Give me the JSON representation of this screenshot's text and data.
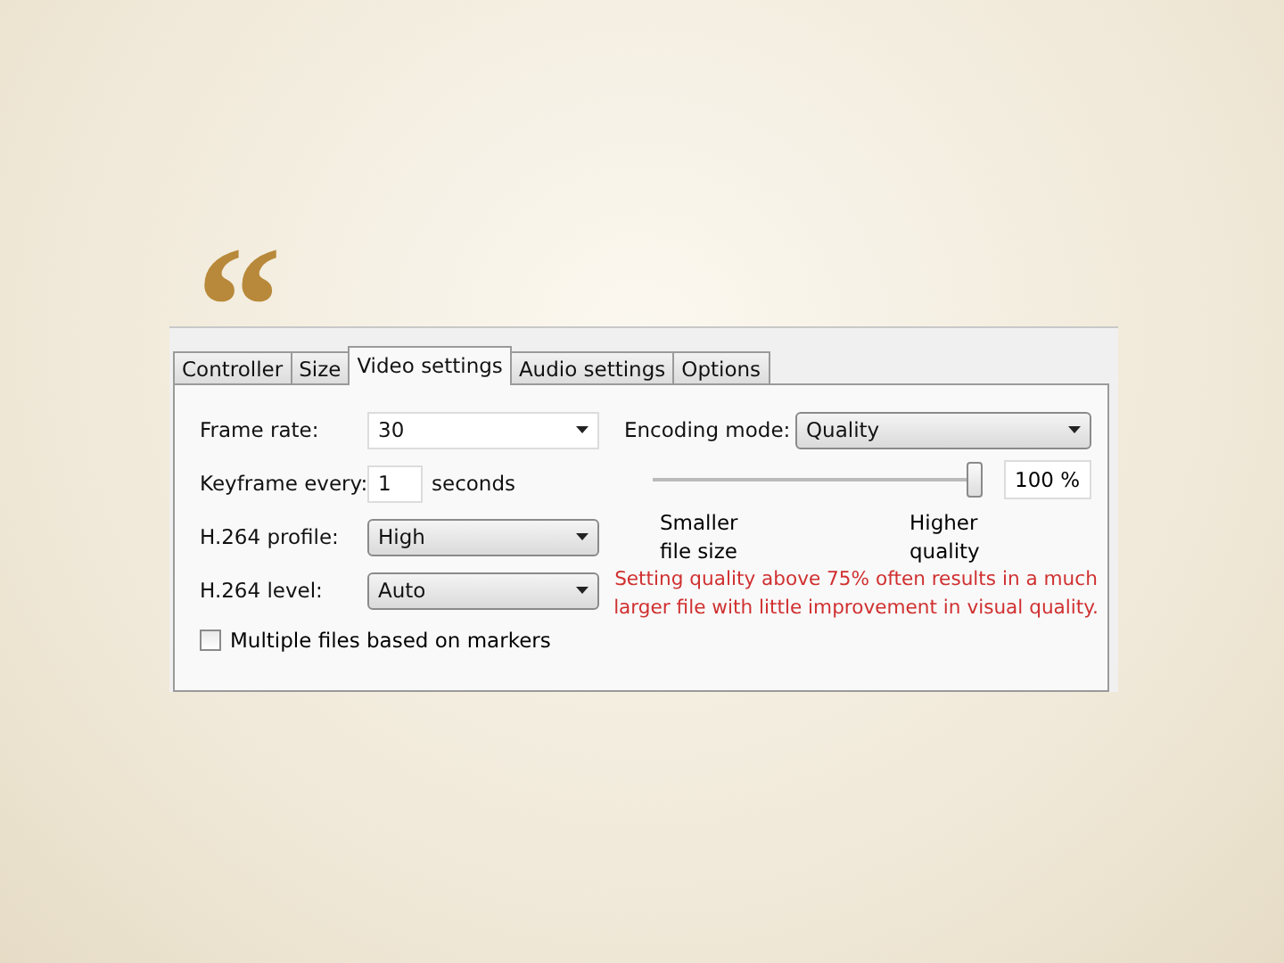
{
  "slide": {
    "quote_mark": "“"
  },
  "tabs": [
    {
      "label": "Controller",
      "selected": false
    },
    {
      "label": "Size",
      "selected": false
    },
    {
      "label": "Video settings",
      "selected": true
    },
    {
      "label": "Audio settings",
      "selected": false
    },
    {
      "label": "Options",
      "selected": false
    }
  ],
  "left_fields": [
    {
      "kind": "dropdown",
      "label": "Frame rate:",
      "value": "30",
      "editable": true
    },
    {
      "kind": "number",
      "label": "Keyframe every:",
      "value": "1",
      "unit": "seconds"
    },
    {
      "kind": "dropdown",
      "label": "H.264 profile:",
      "value": "High",
      "editable": false
    },
    {
      "kind": "dropdown",
      "label": "H.264 level:",
      "value": "Auto",
      "editable": false
    }
  ],
  "markers_checkbox": {
    "label": "Multiple files based on markers",
    "checked": false
  },
  "encoding_mode": {
    "label": "Encoding mode:",
    "value": "Quality"
  },
  "quality_slider": {
    "level": 1,
    "reading": "100 %",
    "min_label": "Smaller file size",
    "max_label": "Higher quality"
  },
  "warning": "Setting quality above 75% often results in a much larger file with little improvement in visual quality."
}
